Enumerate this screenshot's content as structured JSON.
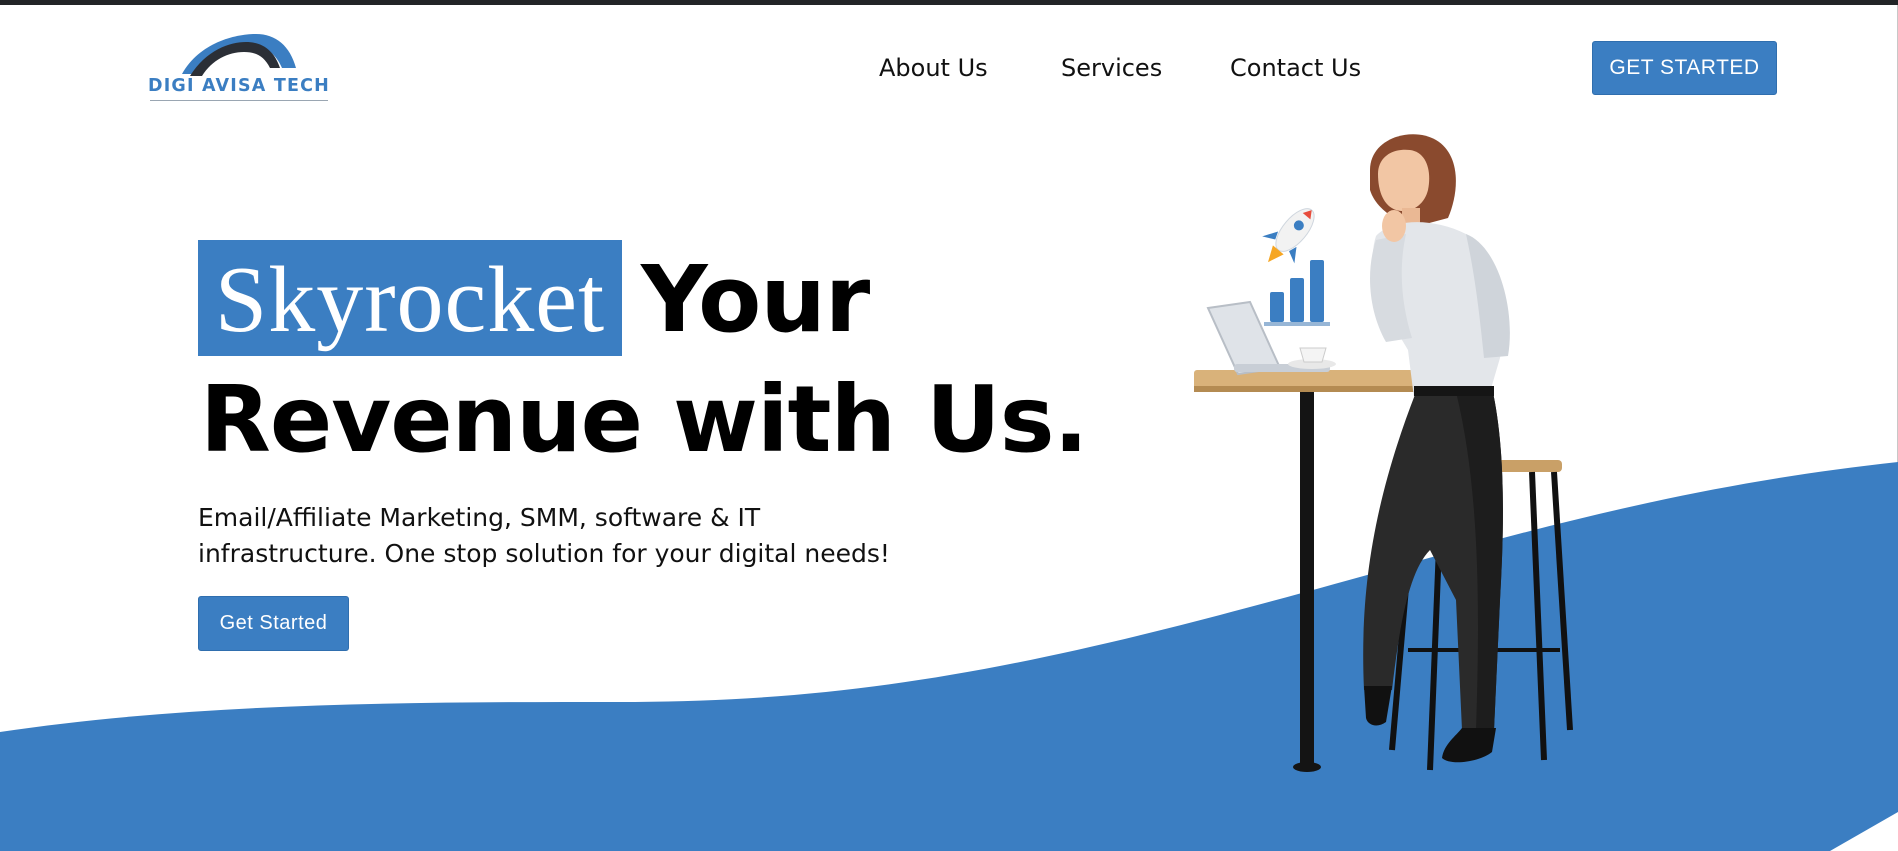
{
  "brand": {
    "name": "DIGI AVISA TECH",
    "primary_color": "#3b7ec2",
    "dark_color": "#222427"
  },
  "nav": {
    "items": [
      "About Us",
      "Services",
      "Contact Us"
    ]
  },
  "header": {
    "cta_label": "GET STARTED"
  },
  "hero": {
    "highlight_word": "Skyrocket",
    "headline_rest_line1": "Your",
    "headline_line2": "Revenue with Us.",
    "subtext": "Email/Affiliate Marketing, SMM, software & IT infrastructure. One stop solution for your digital needs!",
    "cta_label": "Get Started"
  },
  "illustration": {
    "rocket_icon": "rocket-icon",
    "chart_icon": "bar-chart-icon"
  }
}
